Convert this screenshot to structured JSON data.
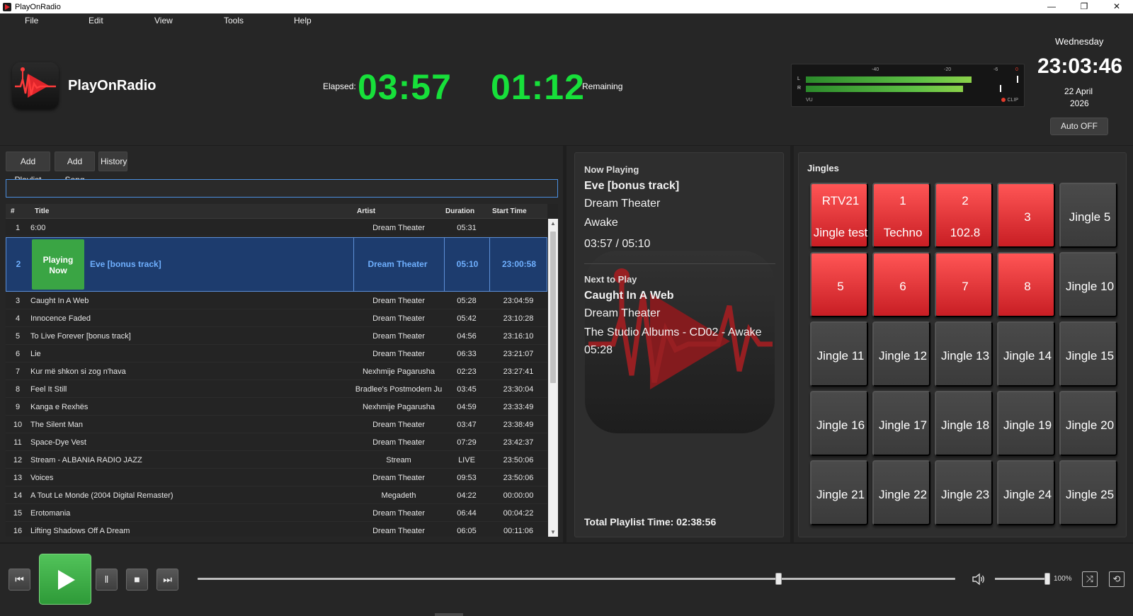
{
  "window": {
    "title": "PlayOnRadio",
    "min": "—",
    "restore": "❐",
    "close": "✕"
  },
  "menu": [
    "File",
    "Edit",
    "View",
    "Tools",
    "Help"
  ],
  "header": {
    "app_name": "PlayOnRadio",
    "elapsed_label": "Elapsed:",
    "elapsed": "03:57",
    "remaining": "01:12",
    "remaining_label": "Remaining",
    "vu": {
      "scale": [
        "-40",
        "-20",
        "-6",
        "0"
      ],
      "left_label": "L",
      "right_label": "R",
      "vu_label": "VU",
      "clip_label": "CLIP",
      "left_level": 0.78,
      "right_level": 0.74
    },
    "day": "Wednesday",
    "clock": "23:03:46",
    "date_line1": "22 April",
    "date_line2": "2026",
    "auto_button": "Auto OFF"
  },
  "playlist": {
    "toolbar": {
      "add_playlist": "Add Playlist",
      "add_song": "Add Song",
      "history": "History"
    },
    "search_value": "",
    "columns": {
      "num": "#",
      "title": "Title",
      "artist": "Artist",
      "duration": "Duration",
      "start": "Start Time"
    },
    "playing_badge_line1": "Playing",
    "playing_badge_line2": "Now",
    "playing": {
      "num": "2",
      "title": "Eve [bonus track]",
      "artist": "Dream Theater",
      "duration": "05:10",
      "start": "23:00:58"
    },
    "row1": {
      "num": "1",
      "title": "6:00",
      "artist": "Dream Theater",
      "duration": "05:31",
      "start": ""
    },
    "rows": [
      {
        "num": "3",
        "title": "Caught In A Web",
        "artist": "Dream Theater",
        "duration": "05:28",
        "start": "23:04:59"
      },
      {
        "num": "4",
        "title": "Innocence Faded",
        "artist": "Dream Theater",
        "duration": "05:42",
        "start": "23:10:28"
      },
      {
        "num": "5",
        "title": "To Live Forever [bonus track]",
        "artist": "Dream Theater",
        "duration": "04:56",
        "start": "23:16:10"
      },
      {
        "num": "6",
        "title": "Lie",
        "artist": "Dream Theater",
        "duration": "06:33",
        "start": "23:21:07"
      },
      {
        "num": "7",
        "title": "Kur më shkon si zog n'hava",
        "artist": "Nexhmije Pagarusha",
        "duration": "02:23",
        "start": "23:27:41"
      },
      {
        "num": "8",
        "title": "Feel It Still",
        "artist": "Bradlee's Postmodern Ju",
        "duration": "03:45",
        "start": "23:30:04"
      },
      {
        "num": "9",
        "title": "Kanga e Rexhës",
        "artist": "Nexhmije Pagarusha",
        "duration": "04:59",
        "start": "23:33:49"
      },
      {
        "num": "10",
        "title": "The Silent Man",
        "artist": "Dream Theater",
        "duration": "03:47",
        "start": "23:38:49"
      },
      {
        "num": "11",
        "title": "Space-Dye Vest",
        "artist": "Dream Theater",
        "duration": "07:29",
        "start": "23:42:37"
      },
      {
        "num": "12",
        "title": "Stream - ALBANIA  RADIO JAZZ",
        "artist": "Stream",
        "duration": "LIVE",
        "start": "23:50:06"
      },
      {
        "num": "13",
        "title": "Voices",
        "artist": "Dream Theater",
        "duration": "09:53",
        "start": "23:50:06"
      },
      {
        "num": "14",
        "title": "A Tout Le Monde (2004 Digital Remaster)",
        "artist": "Megadeth",
        "duration": "04:22",
        "start": "00:00:00"
      },
      {
        "num": "15",
        "title": "Erotomania",
        "artist": "Dream Theater",
        "duration": "06:44",
        "start": "00:04:22"
      },
      {
        "num": "16",
        "title": "Lifting Shadows Off A Dream",
        "artist": "Dream Theater",
        "duration": "06:05",
        "start": "00:11:06"
      }
    ]
  },
  "now_playing": {
    "heading": "Now Playing",
    "title": "Eve [bonus track]",
    "artist": "Dream Theater",
    "album": "Awake",
    "progress": "03:57 / 05:10",
    "next_heading": "Next to Play",
    "next_title": "Caught In A Web",
    "next_artist": "Dream Theater",
    "next_album": "The Studio Albums - CD02 - Awake",
    "next_duration": "05:28",
    "total": "Total Playlist Time: 02:38:56"
  },
  "jingles": {
    "heading": "Jingles",
    "buttons": [
      {
        "l1": "RTV21",
        "l2": "Jingle test",
        "color": "red"
      },
      {
        "l1": "1",
        "l2": "Techno",
        "color": "red"
      },
      {
        "l1": "2",
        "l2": "102.8",
        "color": "red"
      },
      {
        "mid": "3",
        "color": "red"
      },
      {
        "mid": "Jingle 5",
        "color": "gray"
      },
      {
        "mid": "5",
        "color": "red"
      },
      {
        "mid": "6",
        "color": "red"
      },
      {
        "mid": "7",
        "color": "red"
      },
      {
        "mid": "8",
        "color": "red"
      },
      {
        "mid": "Jingle 10",
        "color": "gray"
      },
      {
        "mid": "Jingle 11",
        "color": "gray"
      },
      {
        "mid": "Jingle 12",
        "color": "gray"
      },
      {
        "mid": "Jingle 13",
        "color": "gray"
      },
      {
        "mid": "Jingle 14",
        "color": "gray"
      },
      {
        "mid": "Jingle 15",
        "color": "gray"
      },
      {
        "mid": "Jingle 16",
        "color": "gray"
      },
      {
        "mid": "Jingle 17",
        "color": "gray"
      },
      {
        "mid": "Jingle 18",
        "color": "gray"
      },
      {
        "mid": "Jingle 19",
        "color": "gray"
      },
      {
        "mid": "Jingle 20",
        "color": "gray"
      },
      {
        "mid": "Jingle 21",
        "color": "gray"
      },
      {
        "mid": "Jingle 22",
        "color": "gray"
      },
      {
        "mid": "Jingle 23",
        "color": "gray"
      },
      {
        "mid": "Jingle 24",
        "color": "gray"
      },
      {
        "mid": "Jingle 25",
        "color": "gray"
      }
    ]
  },
  "transport": {
    "prev_icon": "⏮",
    "pause_icon": "‖",
    "stop_icon": "■",
    "next_icon": "⏭",
    "seek_level": 0.766,
    "volume_level": 1.0,
    "volume_label": "100%",
    "shuffle_icon": "⤨",
    "repeat_icon": "⟲"
  },
  "colors": {
    "accent_green": "#17e03a",
    "jingle_red": "#e0252b",
    "selection_blue": "#1d3c6e"
  }
}
